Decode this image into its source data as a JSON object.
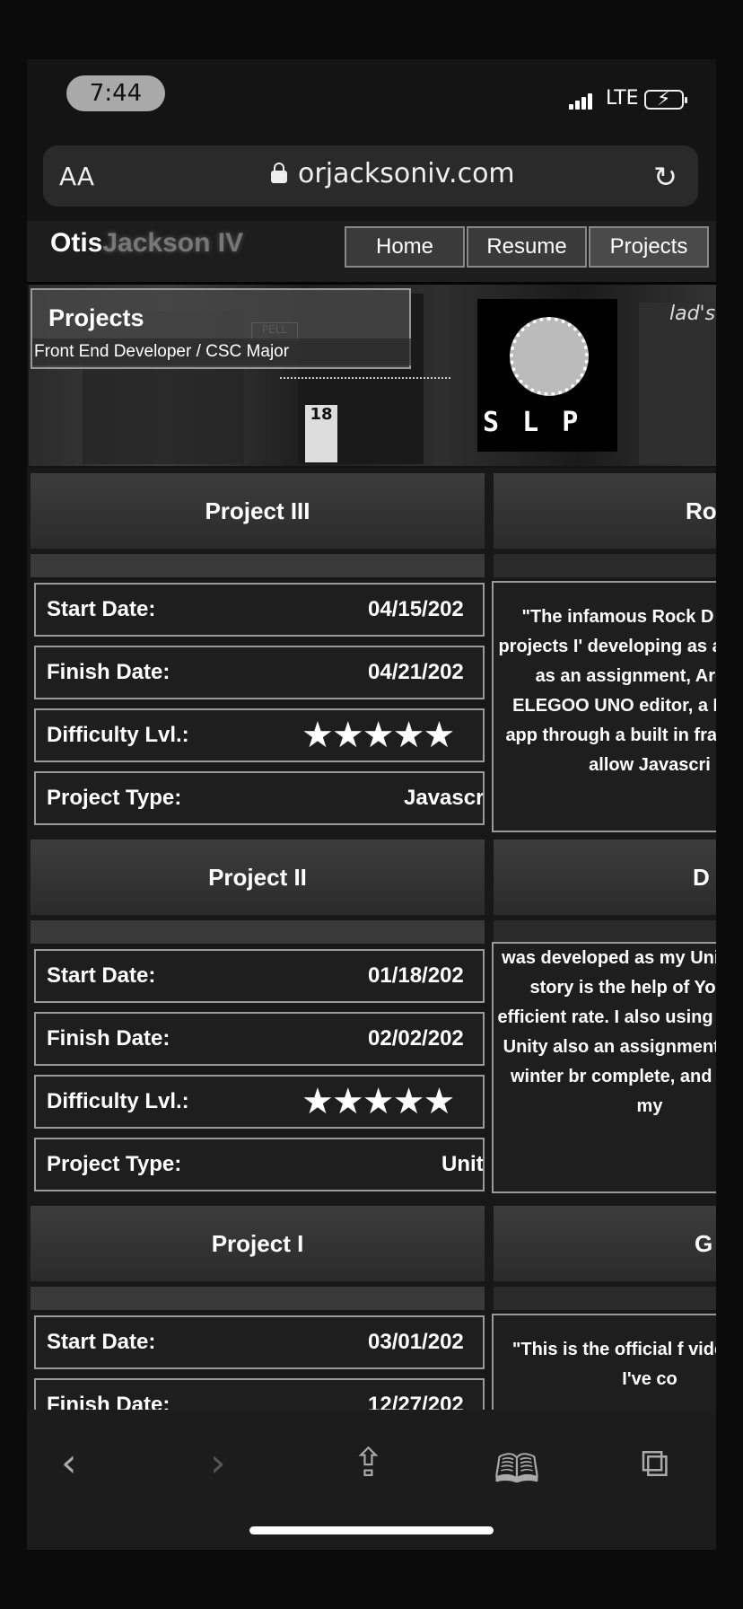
{
  "status": {
    "time": "7:44",
    "network": "LTE"
  },
  "browser": {
    "text_size": "AA",
    "url": "orjacksoniv.com"
  },
  "site": {
    "logo_first": "Otis",
    "logo_last": "Jackson IV",
    "nav": [
      "Home",
      "Resume",
      "Projects"
    ]
  },
  "banner": {
    "title": "Projects",
    "subtitle": "Front End Developer / CSC Major",
    "pixel_text": "S L P"
  },
  "projects": [
    {
      "title": "Project III",
      "right_title": "Ro",
      "start_label": "Start Date:",
      "start": "04/15/202",
      "finish_label": "Finish Date:",
      "finish": "04/21/202",
      "difficulty_label": "Difficulty Lvl.:",
      "difficulty": "★★★★★",
      "type_label": "Project Type:",
      "type": "Javascri",
      "description": "\"The infamous Rock D unique projects I' developing as a youn me as an assignment, Arduino ELEGOO UNO editor, a P5.serial app through a built in fram was to allow Javascri"
    },
    {
      "title": "Project II",
      "right_title": "D",
      "start_label": "Start Date:",
      "start": "01/18/202",
      "finish_label": "Finish Date:",
      "finish": "02/02/202",
      "difficulty_label": "Difficulty Lvl.:",
      "difficulty": "★★★★★",
      "type_label": "Project Type:",
      "type": "Unit",
      "description": "was developed as my Unity. Funny story is the help of Youtube, efficient rate. I also using the actual Unity also an assignment from the winter br complete, and I let with my"
    },
    {
      "title": "Project I",
      "right_title": "G",
      "start_label": "Start Date:",
      "start": "03/01/202",
      "finish_label": "Finish Date:",
      "finish": "12/27/202",
      "description": "\"This is the official f video game I've co"
    }
  ],
  "toolbar": {
    "back": "‹",
    "forward": "›"
  }
}
